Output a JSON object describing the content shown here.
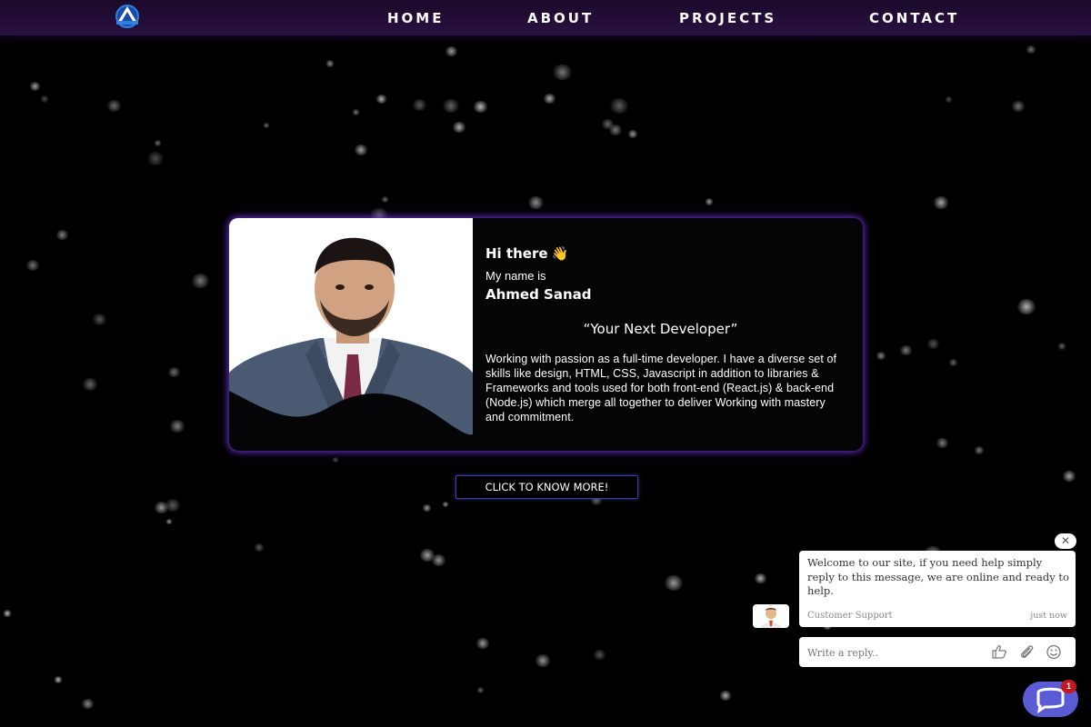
{
  "nav": {
    "items": [
      {
        "label": "HOME"
      },
      {
        "label": "ABOUT"
      },
      {
        "label": "PROJECTS"
      },
      {
        "label": "CONTACT"
      }
    ],
    "logo_icon": "triangle-a-logo-icon"
  },
  "hero": {
    "greeting": "Hi there",
    "greeting_emoji": "👋",
    "name_intro": "My name is",
    "name": "Ahmed Sanad",
    "tagline": "“Your Next Developer”",
    "bio": "Working with passion as a full-time developer. I have a diverse set of skills like design, HTML, CSS, Javascript in addition to libraries & Frameworks and tools used for both front-end (React.js) & back-end (Node.js) which merge all together to deliver Working with mastery and commitment.",
    "cta_label": "CLICK TO KNOW MORE!"
  },
  "chat": {
    "close_symbol": "✕",
    "message": "Welcome to our site, if you need help simply reply to this message, we are online and ready to help.",
    "sender": "Customer Support",
    "time": "just now",
    "reply_placeholder": "Write a reply..",
    "badge_count": "1"
  },
  "colors": {
    "nav_bg": "#22103a",
    "card_glow": "#6e32d2",
    "cta_border": "#3b3ea8",
    "launcher": "#5b5bd6",
    "badge": "#c0191f"
  }
}
